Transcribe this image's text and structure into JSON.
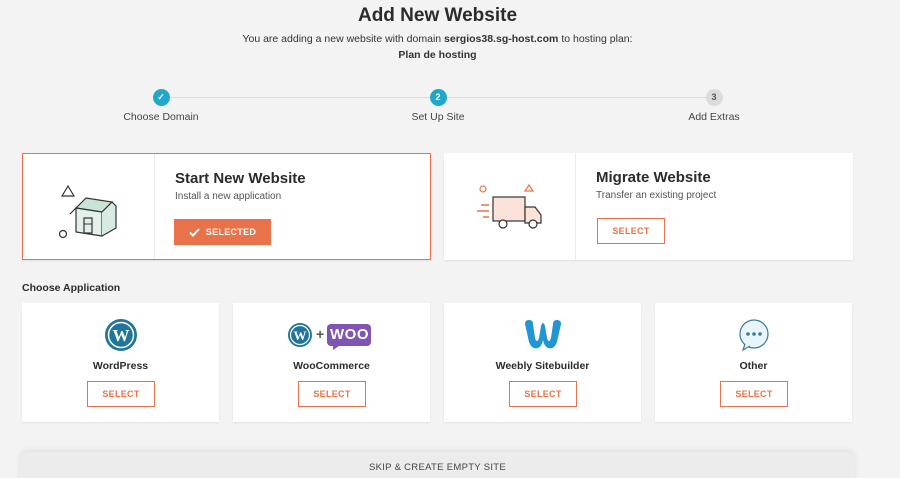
{
  "header": {
    "title": "Add New Website",
    "subtitle_prefix": "You are adding a new website with domain ",
    "domain": "sergios38.sg-host.com",
    "subtitle_suffix": " to hosting plan:",
    "plan": "Plan de hosting"
  },
  "steps": [
    {
      "number": "✓",
      "label": "Choose Domain",
      "state": "done"
    },
    {
      "number": "2",
      "label": "Set Up Site",
      "state": "active"
    },
    {
      "number": "3",
      "label": "Add Extras",
      "state": "todo"
    }
  ],
  "options": {
    "start": {
      "title": "Start New Website",
      "desc": "Install a new application",
      "button": "SELECTED",
      "icon": "house-icon"
    },
    "migrate": {
      "title": "Migrate Website",
      "desc": "Transfer an existing project",
      "button": "SELECT",
      "icon": "truck-icon"
    }
  },
  "section_label": "Choose Application",
  "apps": [
    {
      "name": "WordPress",
      "button": "SELECT",
      "icon": "wordpress-icon"
    },
    {
      "name": "WooCommerce",
      "button": "SELECT",
      "icon": "woocommerce-icon",
      "woo_text": "WOO",
      "plus": "+"
    },
    {
      "name": "Weebly Sitebuilder",
      "button": "SELECT",
      "icon": "weebly-icon"
    },
    {
      "name": "Other",
      "button": "SELECT",
      "icon": "chat-dots-icon"
    }
  ],
  "footer": {
    "skip": "SKIP & CREATE EMPTY SITE"
  },
  "colors": {
    "accent": "#e8734a",
    "step": "#1fa8c9",
    "wordpress": "#21759b",
    "woo": "#7f54b3",
    "weebly": "#2196d3"
  }
}
